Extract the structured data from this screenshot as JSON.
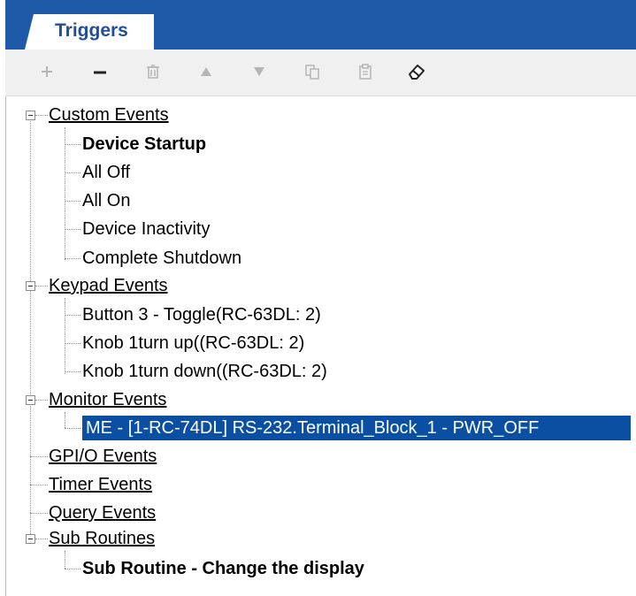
{
  "tab": {
    "label": "Triggers"
  },
  "toolbar": {
    "buttons": [
      {
        "icon": "plus-icon",
        "enabled": false
      },
      {
        "icon": "minus-icon",
        "enabled": true
      },
      {
        "icon": "trash-icon",
        "enabled": false
      },
      {
        "icon": "arrow-up-icon",
        "enabled": false
      },
      {
        "icon": "arrow-down-icon",
        "enabled": false
      },
      {
        "icon": "copy-icon",
        "enabled": false
      },
      {
        "icon": "paste-icon",
        "enabled": false
      },
      {
        "icon": "eraser-icon",
        "enabled": true
      }
    ]
  },
  "tree": {
    "custom_events": {
      "label": "Custom Events",
      "children": [
        "Device Startup",
        "All Off",
        "All On",
        "Device Inactivity",
        "Complete Shutdown"
      ]
    },
    "keypad_events": {
      "label": "Keypad Events",
      "children": [
        "Button 3 - Toggle(RC-63DL: 2)",
        "Knob 1turn up((RC-63DL: 2)",
        "Knob 1turn down((RC-63DL: 2)"
      ]
    },
    "monitor_events": {
      "label": "Monitor Events",
      "children": [
        "ME - [1-RC-74DL] RS-232.Terminal_Block_1 - PWR_OFF"
      ]
    },
    "gpio_events": {
      "label": "GPI/O Events"
    },
    "timer_events": {
      "label": "Timer Events"
    },
    "query_events": {
      "label": "Query Events"
    },
    "sub_routines": {
      "label": "Sub Routines",
      "children": [
        "Sub Routine - Change the display"
      ]
    }
  },
  "colors": {
    "tab_bar": "#1f5aa8",
    "tab_text": "#1f4f9a",
    "selection": "#0a4fa1",
    "toolbar_bg": "#f0f0f0"
  }
}
